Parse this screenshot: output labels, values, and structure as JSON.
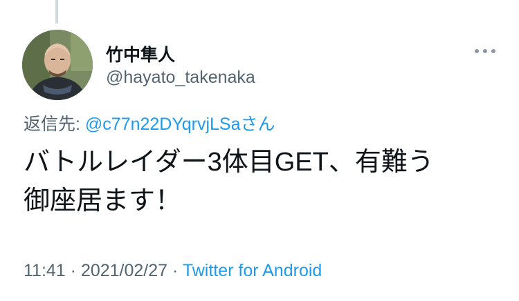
{
  "tweet": {
    "author_name": "竹中隼人",
    "author_handle": "@hayato_takenaka",
    "reply_prefix": "返信先: ",
    "reply_mention": "@c77n22DYqrvjLSaさん",
    "text": "バトルレイダー3体目GET、有難う\n御座居ます！",
    "time": "11:41",
    "separator1": " · ",
    "date": "2021/02/27",
    "separator2": " · ",
    "source": "Twitter for Android"
  },
  "icons": {
    "more": "more-options-icon",
    "avatar": "avatar-photo"
  },
  "colors": {
    "link": "#1d9bf0",
    "secondary_text": "#536471",
    "primary_text": "#0f1419"
  }
}
